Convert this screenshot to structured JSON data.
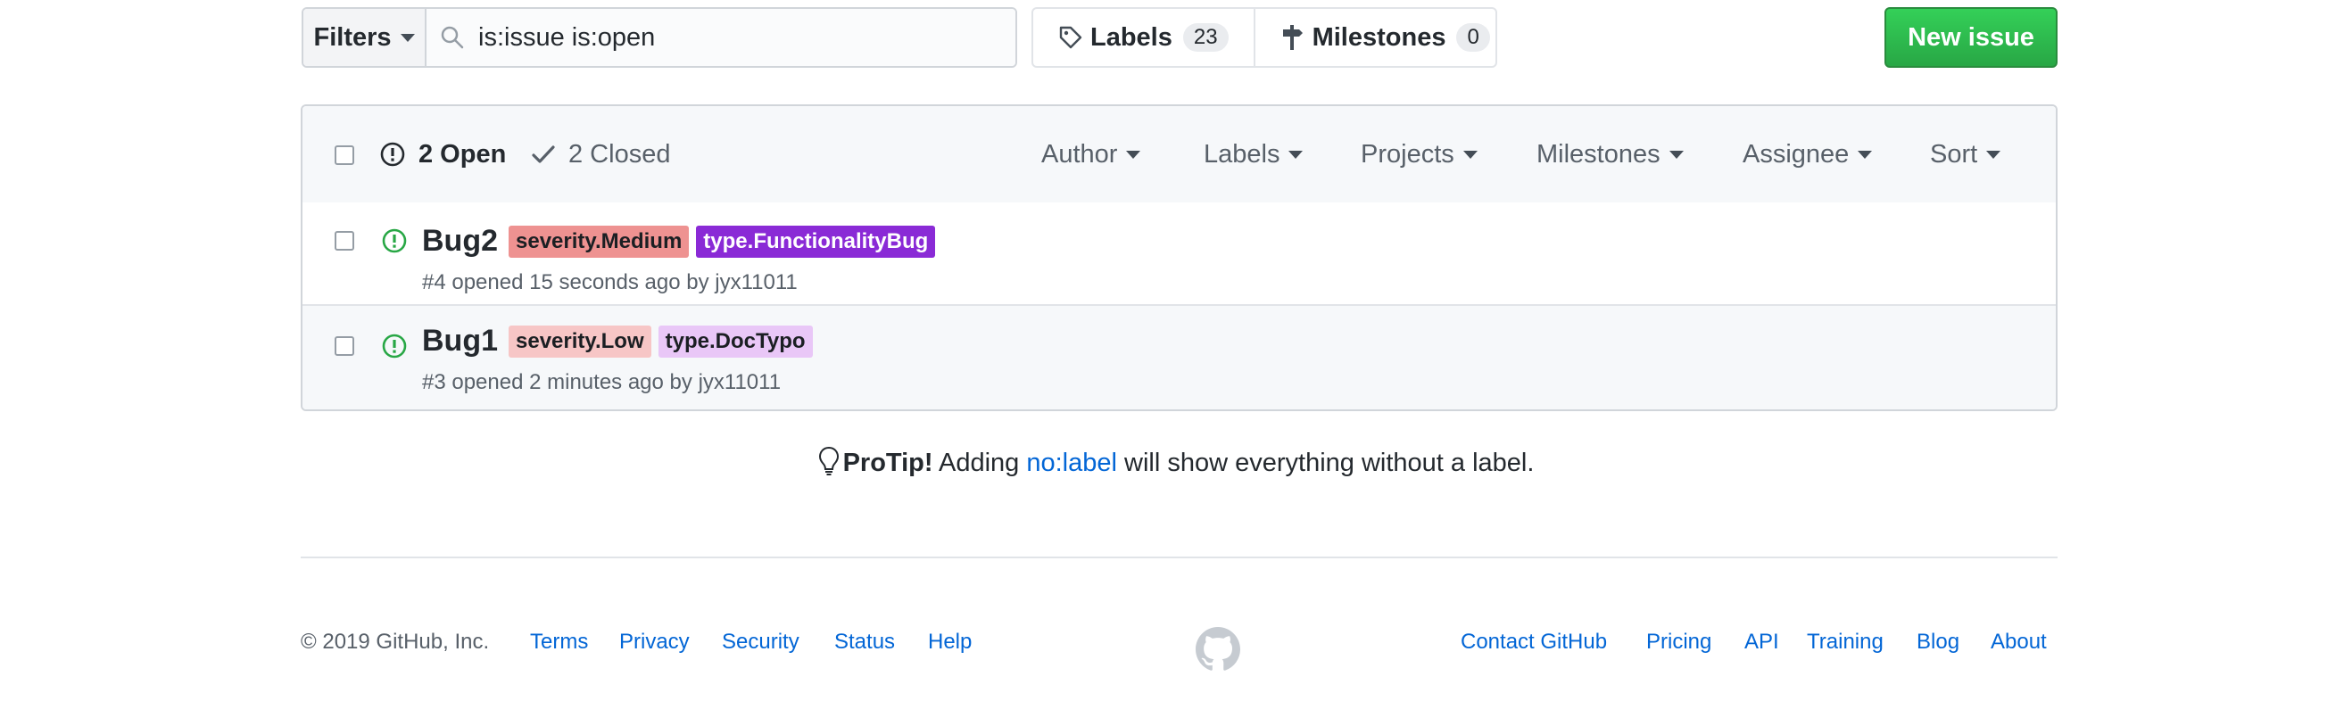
{
  "toolbar": {
    "filters_label": "Filters",
    "search_value": "is:issue is:open",
    "labels_label": "Labels",
    "labels_count": "23",
    "milestones_label": "Milestones",
    "milestones_count": "0",
    "new_issue_label": "New issue"
  },
  "issues_header": {
    "open_label": "2 Open",
    "closed_label": "2 Closed",
    "sort_menus": [
      "Author",
      "Labels",
      "Projects",
      "Milestones",
      "Assignee",
      "Sort"
    ]
  },
  "issues": [
    {
      "title": "Bug2",
      "labels": [
        {
          "name": "severity.Medium",
          "bg": "#ee9291",
          "fg": "#1b1f23"
        },
        {
          "name": "type.FunctionalityBug",
          "bg": "#8a2ad6",
          "fg": "#ffffff"
        }
      ],
      "meta": "#4 opened 15 seconds ago by jyx11011"
    },
    {
      "title": "Bug1",
      "labels": [
        {
          "name": "severity.Low",
          "bg": "#f7c6c6",
          "fg": "#1b1f23"
        },
        {
          "name": "type.DocTypo",
          "bg": "#e9c7f7",
          "fg": "#1b1f23"
        }
      ],
      "meta": "#3 opened 2 minutes ago by jyx11011"
    }
  ],
  "protip": {
    "strong": "ProTip!",
    "before": " Adding ",
    "link": "no:label",
    "after": " will show everything without a label."
  },
  "footer": {
    "copyright": "© 2019 GitHub, Inc.",
    "left_links": [
      "Terms",
      "Privacy",
      "Security",
      "Status",
      "Help"
    ],
    "right_links": [
      "Contact GitHub",
      "Pricing",
      "API",
      "Training",
      "Blog",
      "About"
    ]
  },
  "colors": {
    "accent_link": "#0366d6",
    "open_icon": "#28a745",
    "new_issue_bg": "#2ea44f"
  },
  "icons": [
    "search-icon",
    "tag-icon",
    "milestone-icon",
    "issue-opened-icon",
    "check-icon",
    "light-bulb-icon",
    "github-mark-icon"
  ]
}
